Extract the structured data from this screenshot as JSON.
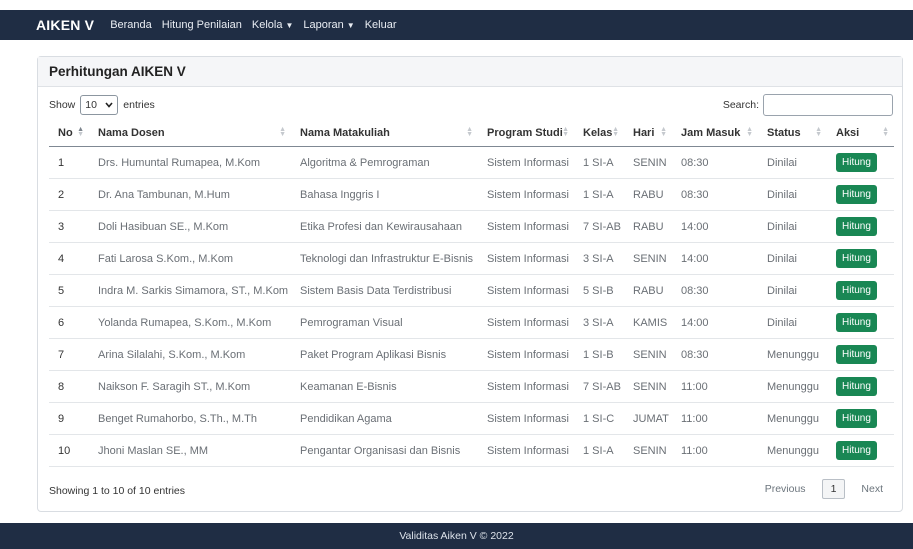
{
  "navbar": {
    "brand": "AIKEN V",
    "links": [
      "Beranda",
      "Hitung Penilaian",
      "Kelola",
      "Laporan",
      "Keluar"
    ]
  },
  "card": {
    "title": "Perhitungan AIKEN V"
  },
  "controls": {
    "show_label": "Show",
    "length_value": "10",
    "entries_label": "entries",
    "search_label": "Search:",
    "search_value": ""
  },
  "table": {
    "headers": [
      "No",
      "Nama Dosen",
      "Nama Matakuliah",
      "Program Studi",
      "Kelas",
      "Hari",
      "Jam Masuk",
      "Status",
      "Aksi"
    ],
    "rows": [
      {
        "no": "1",
        "dosen": "Drs. Humuntal Rumapea, M.Kom",
        "matakuliah": "Algoritma & Pemrograman",
        "prodi": "Sistem Informasi",
        "kelas": "1 SI-A",
        "hari": "SENIN",
        "jam": "08:30",
        "status": "Dinilai",
        "aksi": "Hitung"
      },
      {
        "no": "2",
        "dosen": "Dr. Ana Tambunan, M.Hum",
        "matakuliah": "Bahasa Inggris I",
        "prodi": "Sistem Informasi",
        "kelas": "1 SI-A",
        "hari": "RABU",
        "jam": "08:30",
        "status": "Dinilai",
        "aksi": "Hitung"
      },
      {
        "no": "3",
        "dosen": "Doli Hasibuan SE., M.Kom",
        "matakuliah": "Etika Profesi dan Kewirausahaan",
        "prodi": "Sistem Informasi",
        "kelas": "7 SI-AB",
        "hari": "RABU",
        "jam": "14:00",
        "status": "Dinilai",
        "aksi": "Hitung"
      },
      {
        "no": "4",
        "dosen": "Fati Larosa S.Kom., M.Kom",
        "matakuliah": "Teknologi dan Infrastruktur E-Bisnis",
        "prodi": "Sistem Informasi",
        "kelas": "3 SI-A",
        "hari": "SENIN",
        "jam": "14:00",
        "status": "Dinilai",
        "aksi": "Hitung"
      },
      {
        "no": "5",
        "dosen": "Indra M. Sarkis Simamora, ST., M.Kom",
        "matakuliah": "Sistem Basis Data Terdistribusi",
        "prodi": "Sistem Informasi",
        "kelas": "5 SI-B",
        "hari": "RABU",
        "jam": "08:30",
        "status": "Dinilai",
        "aksi": "Hitung"
      },
      {
        "no": "6",
        "dosen": "Yolanda Rumapea, S.Kom., M.Kom",
        "matakuliah": "Pemrograman Visual",
        "prodi": "Sistem Informasi",
        "kelas": "3 SI-A",
        "hari": "KAMIS",
        "jam": "14:00",
        "status": "Dinilai",
        "aksi": "Hitung"
      },
      {
        "no": "7",
        "dosen": "Arina Silalahi, S.Kom., M.Kom",
        "matakuliah": "Paket Program Aplikasi Bisnis",
        "prodi": "Sistem Informasi",
        "kelas": "1 SI-B",
        "hari": "SENIN",
        "jam": "08:30",
        "status": "Menunggu",
        "aksi": "Hitung"
      },
      {
        "no": "8",
        "dosen": "Naikson F. Saragih ST., M.Kom",
        "matakuliah": "Keamanan E-Bisnis",
        "prodi": "Sistem Informasi",
        "kelas": "7 SI-AB",
        "hari": "SENIN",
        "jam": "11:00",
        "status": "Menunggu",
        "aksi": "Hitung"
      },
      {
        "no": "9",
        "dosen": "Benget Rumahorbo, S.Th., M.Th",
        "matakuliah": "Pendidikan Agama",
        "prodi": "Sistem Informasi",
        "kelas": "1 SI-C",
        "hari": "JUMAT",
        "jam": "11:00",
        "status": "Menunggu",
        "aksi": "Hitung"
      },
      {
        "no": "10",
        "dosen": "Jhoni Maslan SE., MM",
        "matakuliah": "Pengantar Organisasi dan Bisnis",
        "prodi": "Sistem Informasi",
        "kelas": "1 SI-A",
        "hari": "SENIN",
        "jam": "11:00",
        "status": "Menunggu",
        "aksi": "Hitung"
      }
    ]
  },
  "info_text": "Showing 1 to 10 of 10 entries",
  "pagination": {
    "previous": "Previous",
    "current": "1",
    "next": "Next"
  },
  "footer": {
    "text": "Validitas Aiken V © 2022"
  },
  "colors": {
    "navbar": "#1f2d44",
    "button": "#198754"
  }
}
